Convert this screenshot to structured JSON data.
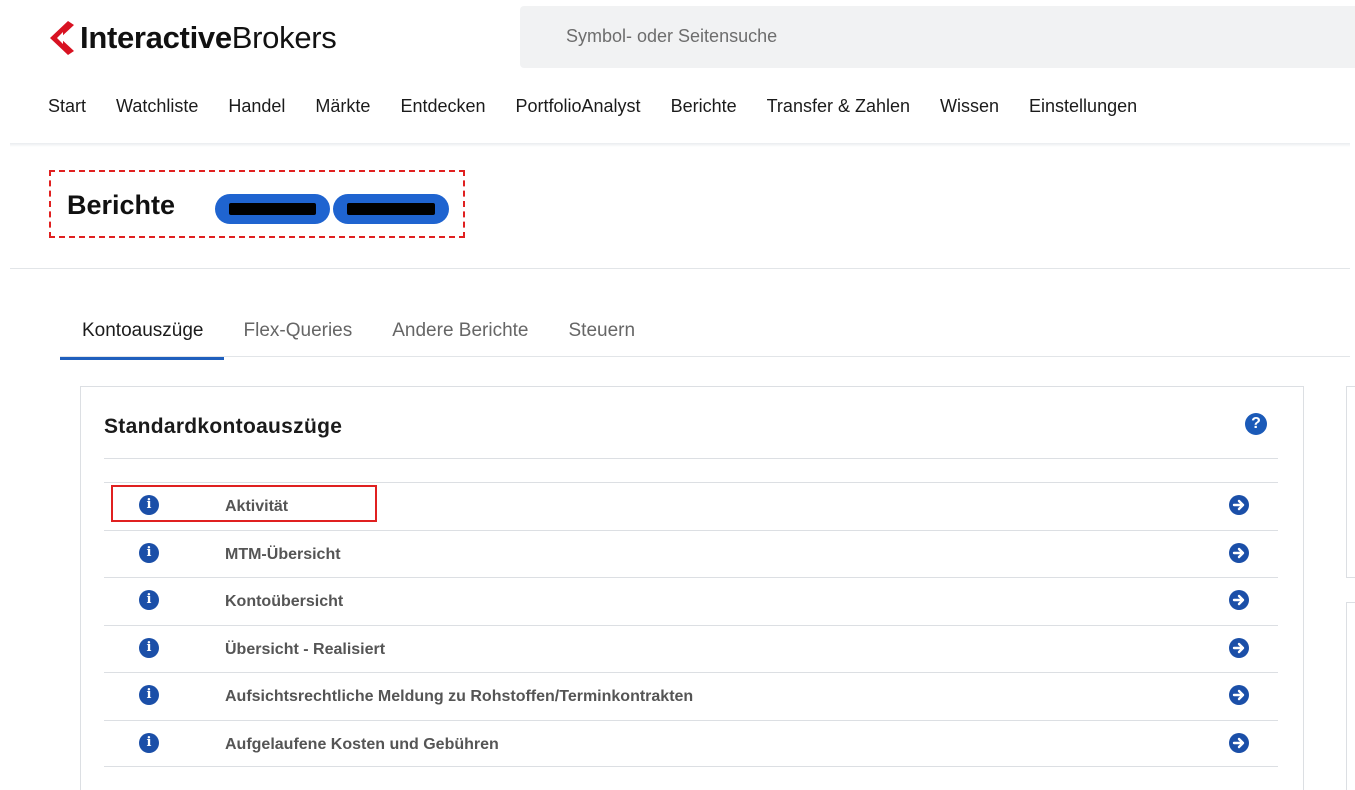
{
  "brand": {
    "name_bold": "Interactive",
    "name_regular": "Brokers",
    "logo_color": "#d81222"
  },
  "search": {
    "placeholder": "Symbol- oder Seitensuche"
  },
  "nav": {
    "items": [
      "Start",
      "Watchliste",
      "Handel",
      "Märkte",
      "Entdecken",
      "PortfolioAnalyst",
      "Berichte",
      "Transfer & Zahlen",
      "Wissen",
      "Einstellungen"
    ]
  },
  "page": {
    "title": "Berichte",
    "account_pill_color": "#1f64d0"
  },
  "tabs": [
    {
      "label": "Kontoauszüge",
      "active": true
    },
    {
      "label": "Flex-Queries",
      "active": false
    },
    {
      "label": "Andere Berichte",
      "active": false
    },
    {
      "label": "Steuern",
      "active": false
    }
  ],
  "panel": {
    "title": "Standardkontoauszüge",
    "help_icon": "question-circle-icon",
    "rows": [
      {
        "label": "Aktivität",
        "highlighted": true
      },
      {
        "label": "MTM-Übersicht"
      },
      {
        "label": "Kontoübersicht"
      },
      {
        "label": "Übersicht - Realisiert"
      },
      {
        "label": "Aufsichtsrechtliche Meldung zu Rohstoffen/Terminkontrakten"
      },
      {
        "label": "Aufgelaufene Kosten und Gebühren"
      }
    ]
  },
  "colors": {
    "accent": "#1b4fa8",
    "highlight": "#e02020",
    "tab_underline": "#1f5fbd"
  }
}
